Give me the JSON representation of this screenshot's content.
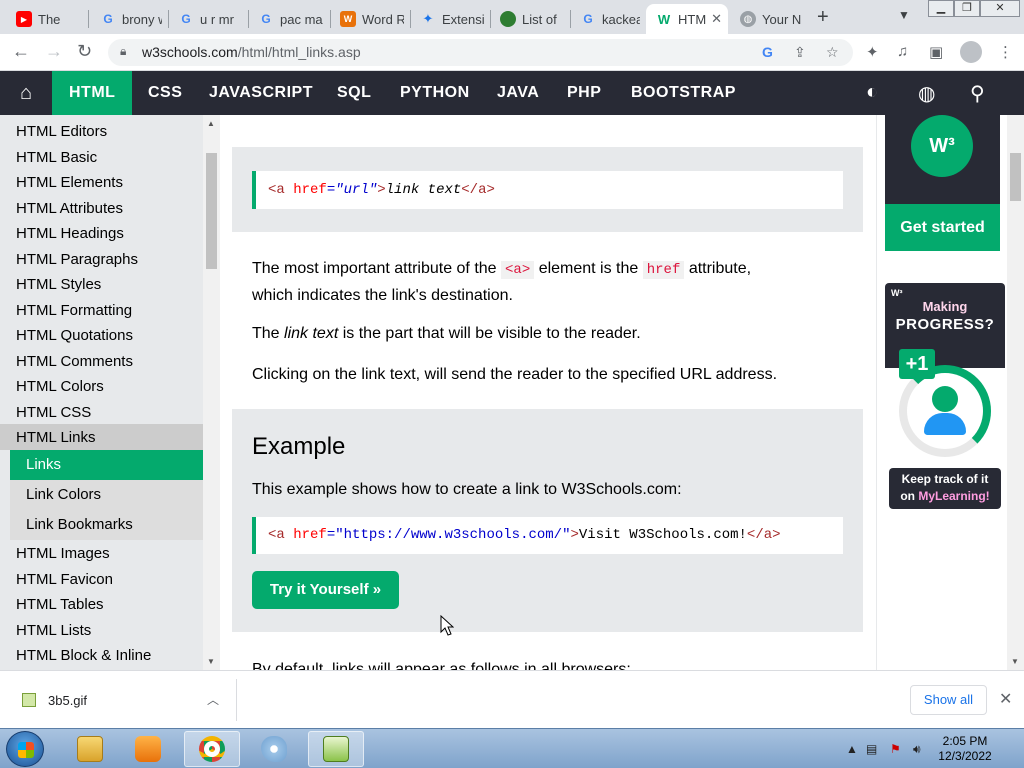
{
  "browser": {
    "tabs": [
      {
        "title": "The",
        "favicon": "youtube-icon",
        "color": "#ff0000"
      },
      {
        "title": "brony w",
        "favicon": "google-icon",
        "color": "#4285f4"
      },
      {
        "title": "u r mr",
        "favicon": "google-icon",
        "color": "#4285f4"
      },
      {
        "title": "pac ma",
        "favicon": "google-icon",
        "color": "#4285f4"
      },
      {
        "title": "Word R",
        "favicon": "word-icon",
        "color": "#e8710a"
      },
      {
        "title": "Extensi",
        "favicon": "puzzle-icon",
        "color": "#1a73e8"
      },
      {
        "title": "List of",
        "favicon": "leaf-icon",
        "color": "#2e7d32"
      },
      {
        "title": "kackea",
        "favicon": "google-icon",
        "color": "#4285f4"
      },
      {
        "title": "HTM",
        "favicon": "w3schools-icon",
        "color": "#04aa6d"
      },
      {
        "title": "Your N",
        "favicon": "globe-icon",
        "color": "#5f6368"
      }
    ],
    "url_host": "w3schools.com",
    "url_path": "/html/html_links.asp"
  },
  "topnav": {
    "items": [
      "HTML",
      "CSS",
      "JAVASCRIPT",
      "SQL",
      "PYTHON",
      "JAVA",
      "PHP",
      "BOOTSTRAP"
    ]
  },
  "sidebar": {
    "items_top": [
      "HTML Editors",
      "HTML Basic",
      "HTML Elements",
      "HTML Attributes",
      "HTML Headings",
      "HTML Paragraphs",
      "HTML Styles",
      "HTML Formatting",
      "HTML Quotations",
      "HTML Comments",
      "HTML Colors",
      "HTML CSS",
      "HTML Links"
    ],
    "sub_items": [
      "Links",
      "Link Colors",
      "Link Bookmarks"
    ],
    "items_bottom": [
      "HTML Images",
      "HTML Favicon",
      "HTML Tables",
      "HTML Lists",
      "HTML Block & Inline"
    ]
  },
  "main": {
    "syntax": {
      "open_tag": "<a ",
      "attr": "href",
      "eq": "=",
      "val": "\"url\"",
      "gt": ">",
      "text": "link text",
      "close_tag": "</a>"
    },
    "p1_a": "The most important attribute of the",
    "p1_code1": "<a>",
    "p1_b": "element is the",
    "p1_code2": "href",
    "p1_c": "attribute,",
    "p1_line2": "which indicates the link's destination.",
    "p2_a": "The",
    "p2_em": "link text",
    "p2_b": "is the part that will be visible to the reader.",
    "p3": "Clicking on the link text, will send the reader to the specified URL address.",
    "example_title": "Example",
    "example_desc": "This example shows how to create a link to W3Schools.com:",
    "example_code": {
      "open_tag": "<a ",
      "attr": "href",
      "eq": "=",
      "val": "\"https://www.w3schools.com/\"",
      "gt": ">",
      "text": "Visit W3Schools.com!",
      "close_tag": "</a>"
    },
    "try_button": "Try it Yourself »",
    "p4": "By default, links will appear as follows in all browsers:"
  },
  "ads": {
    "get_started": "Get started",
    "making": "Making",
    "progress": "PROGRESS?",
    "plus_one": "+1",
    "keep_a": "Keep track of it",
    "keep_b": "on",
    "keep_c": "MyLearning!"
  },
  "download": {
    "file": "3b5.gif",
    "show_all": "Show all"
  },
  "taskbar": {
    "time": "2:05 PM",
    "date": "12/3/2022"
  }
}
